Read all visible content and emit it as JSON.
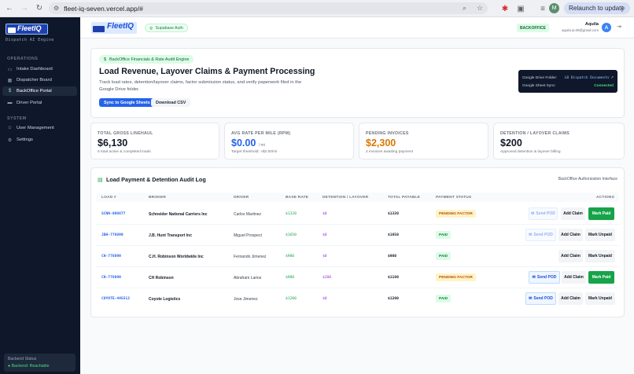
{
  "browser": {
    "url": "fleet-iq-seven.vercel.app/#",
    "relaunch_label": "Relaunch to update",
    "profile_initial": "M"
  },
  "sidebar": {
    "logo_text": "FleetIQ",
    "tagline": "Dispatch AI Engine",
    "sections": [
      {
        "title": "OPERATIONS",
        "items": [
          {
            "label": "Intake Dashboard",
            "icon": "inbox-icon"
          },
          {
            "label": "Dispatcher Board",
            "icon": "grid-icon"
          },
          {
            "label": "BackOffice Portal",
            "icon": "dollar-icon"
          },
          {
            "label": "Driver Portal",
            "icon": "truck-icon"
          }
        ]
      },
      {
        "title": "SYSTEM",
        "items": [
          {
            "label": "User Management",
            "icon": "users-icon"
          },
          {
            "label": "Settings",
            "icon": "gear-icon"
          }
        ]
      }
    ],
    "backend_status": {
      "title": "Backend Status",
      "value": "Backend: Reachable"
    }
  },
  "topbar": {
    "logo_text": "FleetIQ",
    "auth_badge": "Supabase Auth",
    "role_badge": "BACKOFFICE",
    "user_name": "Aquila",
    "user_email": "aquila.ai.08@gmail.com",
    "avatar_initial": "A"
  },
  "hero": {
    "badge": "BackOffice Financials & Rate Audit Engine",
    "title": "Load Revenue, Layover Claims & Payment Processing",
    "description": "Track load rates, detention/layover claims, factor submission status, and verify paperwork filed in the Google Drive folder.",
    "sync_button": "Sync to Google Sheets",
    "csv_button": "Download CSV",
    "drive_label": "Google Drive Folder:",
    "drive_link": "LB Dispatch Documents",
    "sheet_label": "Google Sheet Sync:",
    "sheet_status": "Connected"
  },
  "stats": [
    {
      "label": "TOTAL GROSS LINEHAUL",
      "value": "$6,130",
      "unit": "",
      "sub": "5 total active & completed loads",
      "color": "#111827"
    },
    {
      "label": "AVG RATE PER MILE (RPM)",
      "value": "$0.00",
      "unit": "/ mi",
      "sub": "Target threshold: >$2.50/mi",
      "color": "#2563eb"
    },
    {
      "label": "PENDING INVOICES",
      "value": "$2,300",
      "unit": "",
      "sub": "2 invoices awaiting payment",
      "color": "#d97706"
    },
    {
      "label": "DETENTION / LAYOVER CLAIMS",
      "value": "$200",
      "unit": "",
      "sub": "Approved detention & layover billing",
      "color": "#111827"
    }
  ],
  "log": {
    "title": "Load Payment & Detention Audit Log",
    "auth_label": "BackOffice Authorization Interface",
    "columns": [
      "LOAD #",
      "BROKER",
      "DRIVER",
      "BASE RATE",
      "DETENTION / LAYOVER",
      "TOTAL PAYABLE",
      "PAYMENT STATUS",
      "ACTIONS"
    ],
    "rows": [
      {
        "load": "SCNN-098877",
        "broker": "Schneider National Carriers Inc",
        "driver": "Carlos Martinez",
        "base": "$1320",
        "det": "$0",
        "total": "$1320",
        "status": "PENDING FACTOR",
        "send": "Send POD",
        "claim": "Add Claim",
        "toggle": "Mark Paid"
      },
      {
        "load": "JBH-778899",
        "broker": "J.B. Hunt Transport Inc",
        "driver": "Miguel Prospect",
        "base": "$1650",
        "det": "$0",
        "total": "$1650",
        "status": "PAID",
        "send": "Send POD",
        "claim": "Add Claim",
        "toggle": "Mark Unpaid"
      },
      {
        "load": "CH-778899",
        "broker": "C.H. Robinson Worldwide Inc",
        "driver": "Fernando Jimenez",
        "base": "$980",
        "det": "$0",
        "total": "$980",
        "status": "PAID",
        "send": "",
        "claim": "Add Claim",
        "toggle": "Mark Unpaid"
      },
      {
        "load": "CH-778899",
        "broker": "CH Robinson",
        "driver": "Abraham Larios",
        "base": "$980",
        "det": "$200",
        "total": "$1180",
        "status": "PENDING FACTOR",
        "send": "Send POD",
        "claim": "Add Claim",
        "toggle": "Mark Paid"
      },
      {
        "load": "COYOTE-445512",
        "broker": "Coyote Logistics",
        "driver": "Jose Jimenez",
        "base": "$1200",
        "det": "$0",
        "total": "$1200",
        "status": "PAID",
        "send": "Send POD",
        "claim": "Add Claim",
        "toggle": "Mark Unpaid"
      }
    ]
  }
}
